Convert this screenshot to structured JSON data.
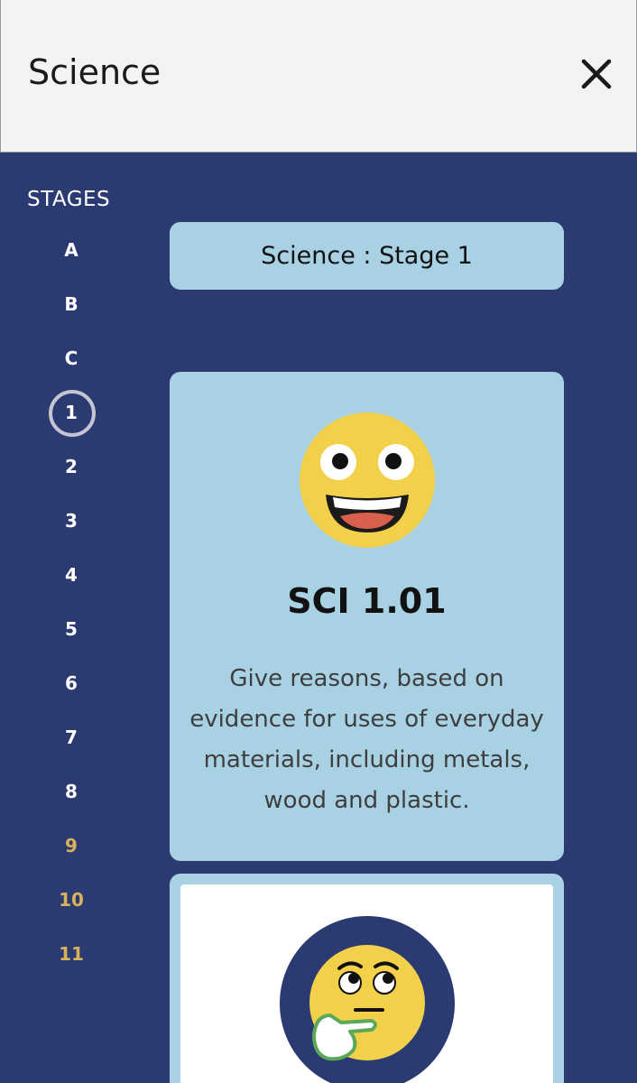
{
  "header": {
    "title": "Science"
  },
  "sidebar": {
    "title": "STAGES",
    "stages": [
      "A",
      "B",
      "C",
      "1",
      "2",
      "3",
      "4",
      "5",
      "6",
      "7",
      "8",
      "9",
      "10",
      "11"
    ]
  },
  "main": {
    "stage_label": "Science : Stage 1",
    "cards": [
      {
        "code": "SCI 1.01",
        "description": "Give reasons, based on evidence for uses of everyday materials, including metals, wood and plastic."
      }
    ]
  },
  "colors": {
    "background": "#2c3a72",
    "card": "#a9d1e4",
    "accent_gold": "#d9b35c",
    "emoji_yellow": "#f2d04a"
  },
  "icons": {
    "close": "close-icon",
    "card1": "grinning-face-icon",
    "card2": "thinking-face-icon"
  }
}
